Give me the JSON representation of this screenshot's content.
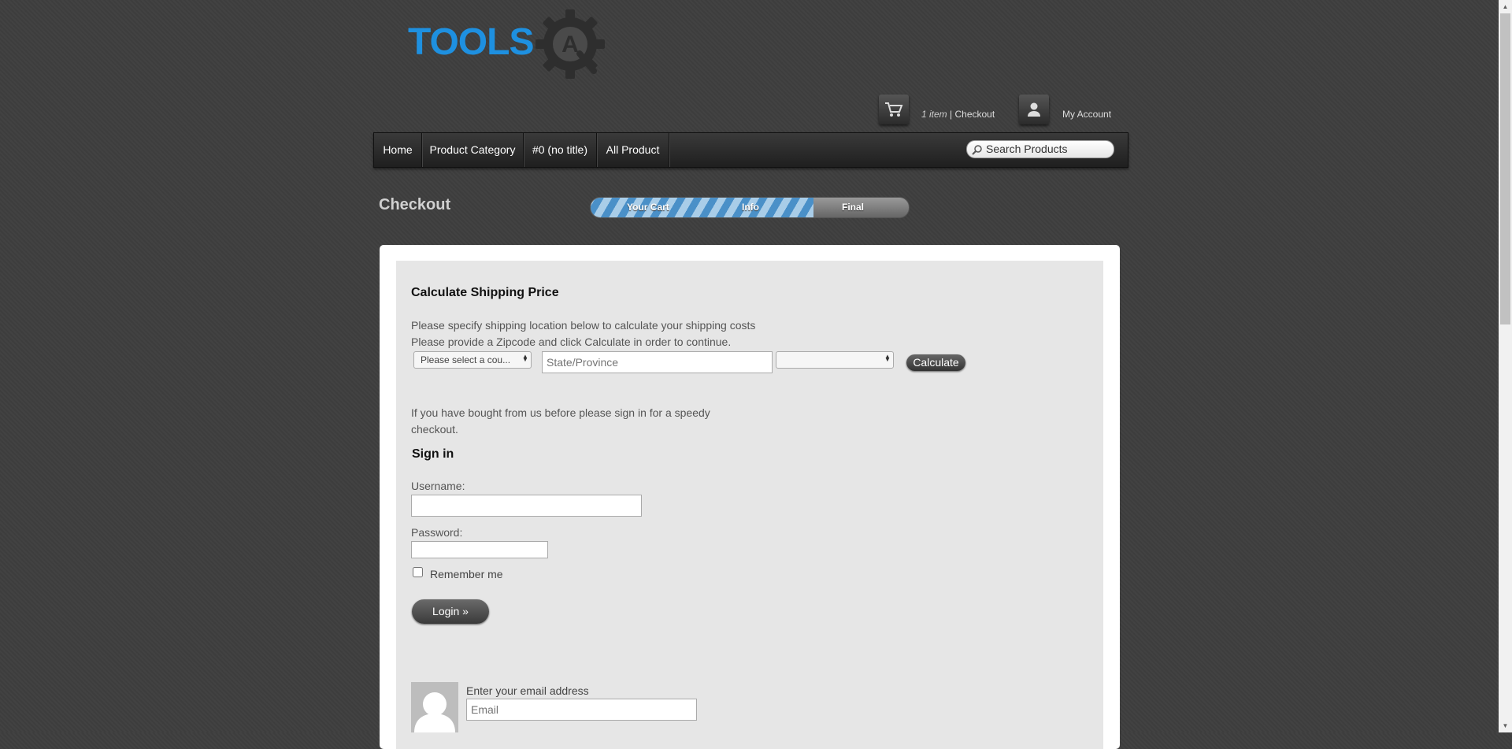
{
  "logo": {
    "text": "TOOLS",
    "badge_letter": "A"
  },
  "header": {
    "cart_count": "1 item",
    "cart_separator": " | ",
    "cart_checkout": "Checkout",
    "account": "My Account"
  },
  "nav": {
    "items": [
      "Home",
      "Product Category",
      "#0 (no title)",
      "All Product"
    ],
    "search_placeholder": "Search Products"
  },
  "checkout": {
    "title": "Checkout",
    "steps": [
      "Your Cart",
      "Info",
      "Final"
    ],
    "progress_fraction": 0.7
  },
  "shipping": {
    "heading": "Calculate Shipping Price",
    "line1": "Please specify shipping location below to calculate your shipping costs",
    "line2": "Please provide a Zipcode and click Calculate in order to continue.",
    "country_placeholder": "Please select a cou...",
    "state_placeholder": "State/Province",
    "region_value": "",
    "calculate_label": "Calculate"
  },
  "signin": {
    "intro_line1": "If you have bought from us before please sign in for a speedy",
    "intro_line2": "checkout.",
    "heading": "Sign in",
    "username_label": "Username:",
    "password_label": "Password:",
    "remember_label": "Remember me",
    "login_label": "Login »"
  },
  "email": {
    "label": "Enter your email address",
    "placeholder": "Email"
  },
  "colors": {
    "logo_blue": "#1e90e0",
    "page_bg": "#3f3f3f",
    "progress_stripe": "#4a90c8"
  }
}
